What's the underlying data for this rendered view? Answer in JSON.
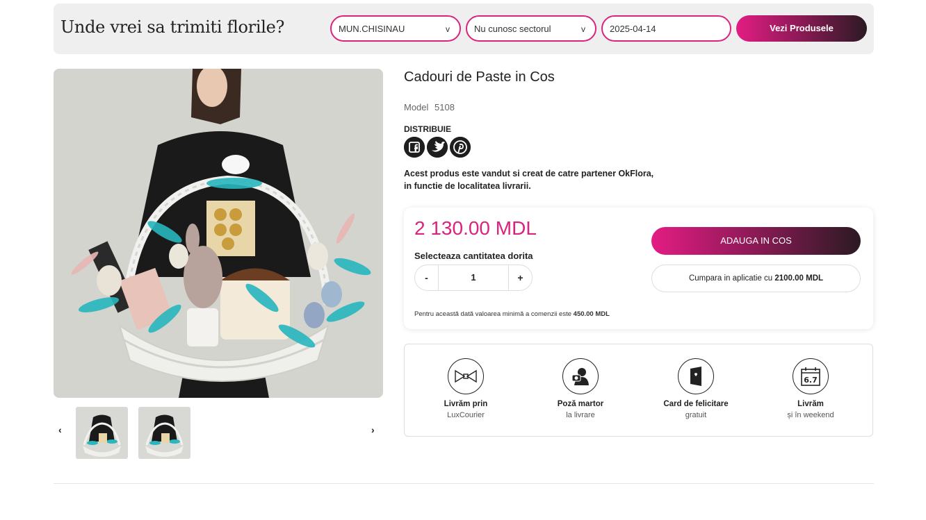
{
  "search": {
    "title": "Unde vrei sa trimiti florile?",
    "city": "MUN.CHISINAU",
    "sector": "Nu cunosc sectorul",
    "date": "2025-04-14",
    "chevron": "v",
    "button": "Vezi Produsele"
  },
  "product": {
    "title": "Cadouri de Paste in Cos",
    "model_label": "Model",
    "model_value": "5108",
    "share_label": "DISTRIBUIE",
    "partner_line1": "Acest produs este vandut si creat de catre partener OkFlora,",
    "partner_line2": "in functie de localitatea livrarii.",
    "social_icons": [
      "facebook-icon",
      "twitter-icon",
      "pinterest-icon"
    ]
  },
  "pricing": {
    "price": "2 130.00 MDL",
    "qty_label": "Selecteaza cantitatea dorita",
    "qty_minus": "-",
    "qty_value": "1",
    "qty_plus": "+",
    "add_button": "ADAUGA IN COS",
    "app_text": "Cumpara in aplicatie cu",
    "app_price": "2100.00 MDL",
    "min_note_text": "Pentru această dată valoarea minimă a comenzii este",
    "min_note_value": "450.00 MDL"
  },
  "features": [
    {
      "icon": "bow-icon",
      "line1": "Livrăm prin",
      "line2": "LuxCourier"
    },
    {
      "icon": "camera-person-icon",
      "line1": "Poză martor",
      "line2": "la livrare"
    },
    {
      "icon": "card-icon",
      "line1": "Card de felicitare",
      "line2": "gratuit"
    },
    {
      "icon": "calendar-icon",
      "line1": "Livrăm",
      "line2": "și în weekend"
    }
  ],
  "gallery": {
    "prev": "‹",
    "next": "›"
  },
  "colors": {
    "accent": "#d9237d",
    "dark": "#2b1a22"
  }
}
